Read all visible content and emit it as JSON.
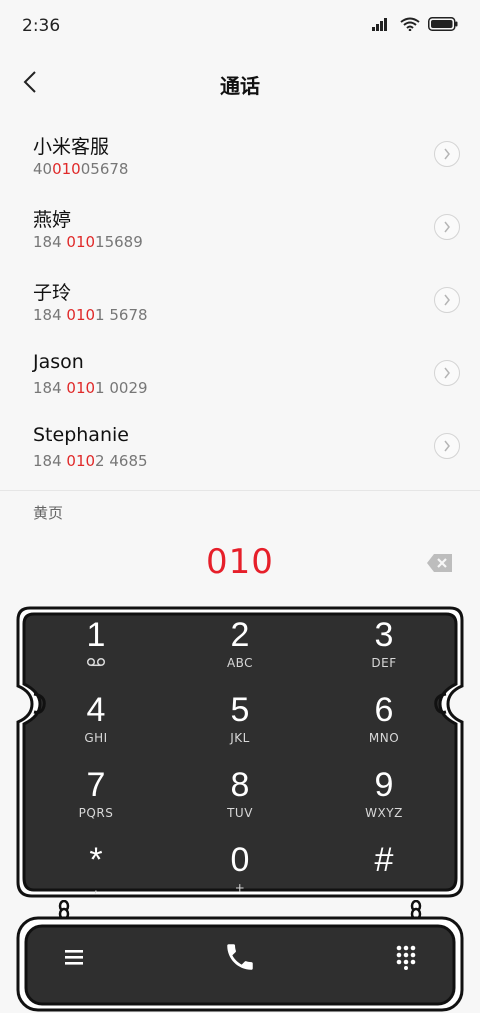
{
  "status_bar": {
    "time": "2:36",
    "icons": [
      "signal-icon",
      "wifi-icon",
      "battery-icon"
    ]
  },
  "header": {
    "title": "通话",
    "back_icon": "back-chevron-icon"
  },
  "contacts": [
    {
      "name": "小米客服",
      "number_pre": "40",
      "number_hl": "010",
      "number_post": "05678"
    },
    {
      "name": "燕婷",
      "number_pre": "184 ",
      "number_hl": "010",
      "number_post": "15689"
    },
    {
      "name": "子玲",
      "number_pre": "184 ",
      "number_hl": "010",
      "number_post": "1 5678"
    },
    {
      "name": "Jason",
      "number_pre": "184 ",
      "number_hl": "010",
      "number_post": "1 0029"
    },
    {
      "name": "Stephanie",
      "number_pre": "184 ",
      "number_hl": "010",
      "number_post": "2 4685"
    }
  ],
  "yellow_pages": "黄页",
  "dialed_number": "010",
  "keypad": [
    {
      "digit": "1",
      "sub": "",
      "sub_icon": "voicemail-icon"
    },
    {
      "digit": "2",
      "sub": "ABC"
    },
    {
      "digit": "3",
      "sub": "DEF"
    },
    {
      "digit": "4",
      "sub": "GHI"
    },
    {
      "digit": "5",
      "sub": "JKL"
    },
    {
      "digit": "6",
      "sub": "MNO"
    },
    {
      "digit": "7",
      "sub": "PQRS"
    },
    {
      "digit": "8",
      "sub": "TUV"
    },
    {
      "digit": "9",
      "sub": "WXYZ"
    },
    {
      "digit": "*",
      "sub": ","
    },
    {
      "digit": "0",
      "sub": "+"
    },
    {
      "digit": "#",
      "sub": ""
    }
  ],
  "colors": {
    "accent_red": "#e61f2a",
    "keypad_bg": "#2f2f2f",
    "keypad_border": "#111111",
    "background": "#f7f7f7"
  }
}
